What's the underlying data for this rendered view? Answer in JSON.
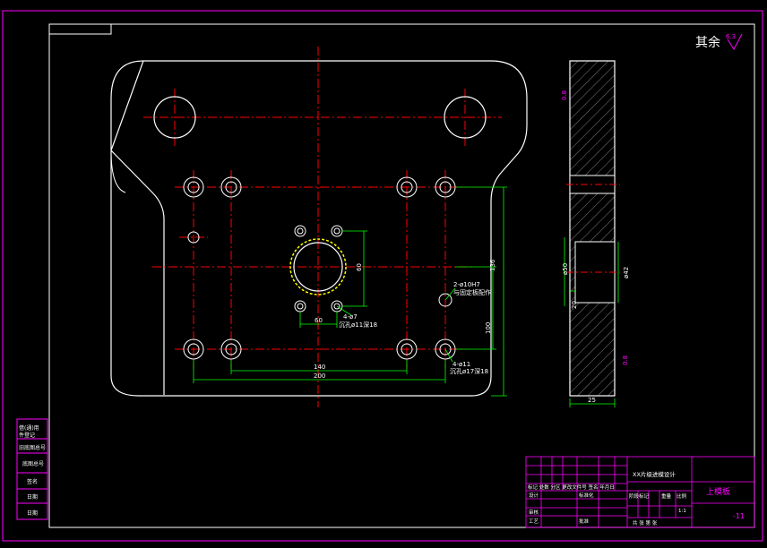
{
  "drawing": {
    "roughness": "其余",
    "roughness_value": "6.3",
    "part_name": "上模板",
    "drawing_no": "-11",
    "project_title": "XX片级进模设计",
    "scale": "1:1"
  },
  "dimensions": {
    "horiz_140": "140",
    "horiz_200": "200",
    "horiz_60": "60",
    "vert_60": "60",
    "vert_100": "100",
    "vert_136": "136",
    "thickness_25": "25",
    "dia_50": "ø50",
    "dia_42": "ø42",
    "surface_top": "0.8",
    "surface_bottom": "0.8",
    "side_depth": "20"
  },
  "notes": {
    "note_4x": "4-ø7",
    "note_4x_sub": "沉孔ø11深18",
    "note_4x_b": "4-ø11",
    "note_4x_b_sub": "沉孔ø17深18",
    "note_pin": "2-ø10H7",
    "note_pin_sub": "与固定板配作"
  },
  "side_stamp": {
    "row1": "借(通)用",
    "row2": "件登记",
    "row3": "旧底图总号",
    "row4": "底图总号",
    "row5": "签名",
    "row6": "日期",
    "row7": "日期"
  },
  "title_block": {
    "mark_row": "标记 处数 分区 更改文件号 签名 年月日",
    "design": "设计",
    "standardize": "标准化",
    "check": "审核",
    "process": "工艺",
    "approve": "批准",
    "stage_mark": "阶段标记",
    "weight": "重量",
    "scale_label": "比例",
    "sheets": "共   张   第   张"
  },
  "colors": {
    "frame": "#ff00ff",
    "outline": "#ffffff",
    "center": "#ff0000",
    "dim": "#00ff00",
    "hatch": "#a0a0a0",
    "note": "#ffffff"
  }
}
